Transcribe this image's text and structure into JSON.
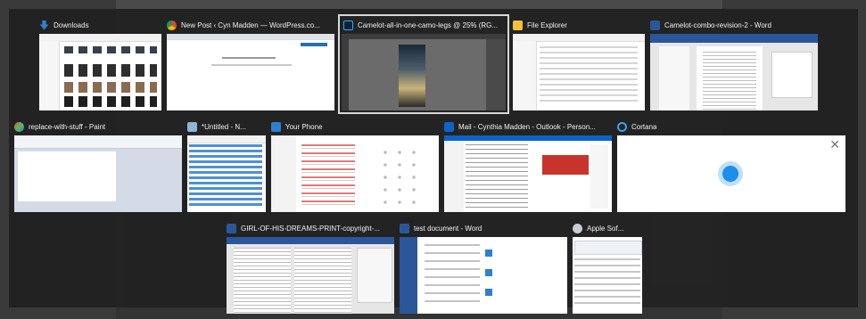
{
  "taskview": {
    "rows": [
      [
        {
          "title": "Downloads",
          "icon": "downloads-folder-icon",
          "selected": false
        },
        {
          "title": "New Post ‹ Cyn Madden — WordPress.co...",
          "icon": "chrome-icon",
          "selected": false
        },
        {
          "title": "Camelot-all-in-one-camo-legs @ 25% (RG...",
          "icon": "photoshop-icon",
          "selected": true
        },
        {
          "title": "File Explorer",
          "icon": "file-explorer-icon",
          "selected": false
        },
        {
          "title": "Camelot-combo-revision-2 - Word",
          "icon": "word-icon",
          "selected": false
        }
      ],
      [
        {
          "title": "replace-with-stuff - Paint",
          "icon": "paint-icon",
          "selected": false
        },
        {
          "title": "*Untitled - N...",
          "icon": "notepad-icon",
          "selected": false
        },
        {
          "title": "Your Phone",
          "icon": "your-phone-icon",
          "selected": false
        },
        {
          "title": "Mail - Cynthia Madden - Outlook - Person...",
          "icon": "outlook-icon",
          "selected": false
        },
        {
          "title": "Cortana",
          "icon": "cortana-icon",
          "selected": false,
          "close": "✕"
        }
      ],
      [
        {
          "title": "GIRL-OF-HIS-DREAMS-PRINT-copyright-...",
          "icon": "word-icon",
          "selected": false
        },
        {
          "title": "test document - Word",
          "icon": "word-icon",
          "selected": false
        },
        {
          "title": "Apple Sof...",
          "icon": "apple-software-update-icon",
          "selected": false
        }
      ]
    ]
  },
  "colors": {
    "background": "#202020",
    "selection_border": "#d8d8d8",
    "cortana_blue": "#3aa0f0",
    "word_blue": "#2b579a"
  }
}
